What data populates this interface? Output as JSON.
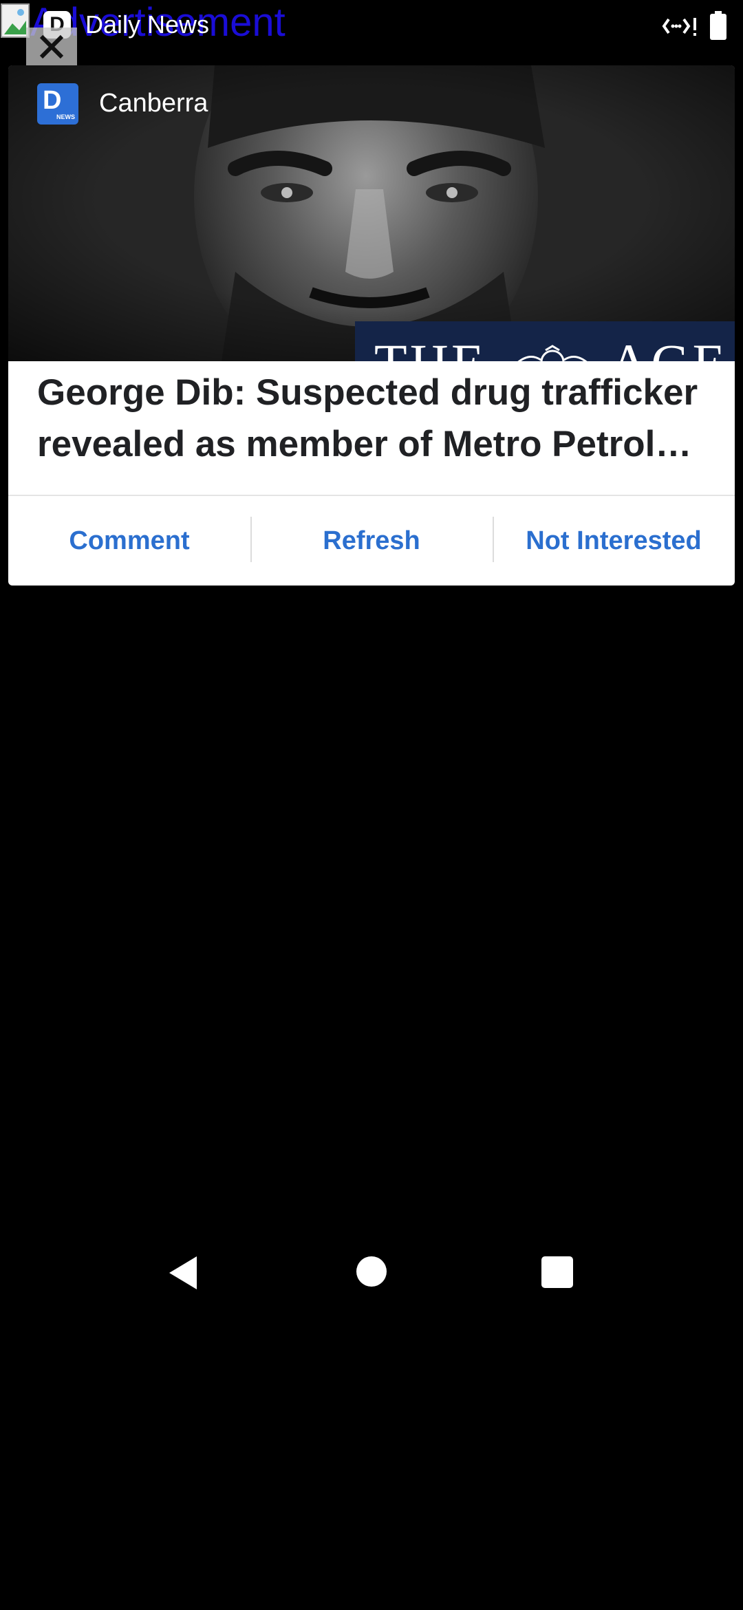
{
  "status_bar": {
    "ad_text": "Advertisement",
    "app_icon_letter": "D",
    "app_title": "Daily News",
    "close_glyph": "✕",
    "icons": [
      "broken-image-icon",
      "signal-icon",
      "battery-icon"
    ]
  },
  "notification": {
    "source_icon": {
      "letter": "D",
      "sub": "NEWS"
    },
    "source_name": "Canberra",
    "masthead_text_left": "THE",
    "masthead_text_right": "AGE",
    "headline": "George Dib: Suspected drug trafficker revealed as member of Metro Petrol…",
    "actions": [
      {
        "label": "Comment"
      },
      {
        "label": "Refresh"
      },
      {
        "label": "Not Interested"
      }
    ]
  },
  "nav_bar": {
    "icons": [
      "back-icon",
      "home-icon",
      "recents-icon"
    ]
  },
  "colors": {
    "accent": "#2b6fcf",
    "ad_text": "#1a0dd6",
    "source_icon_bg": "#2d6fd6",
    "masthead_bg": "#142448",
    "background": "#000000"
  }
}
